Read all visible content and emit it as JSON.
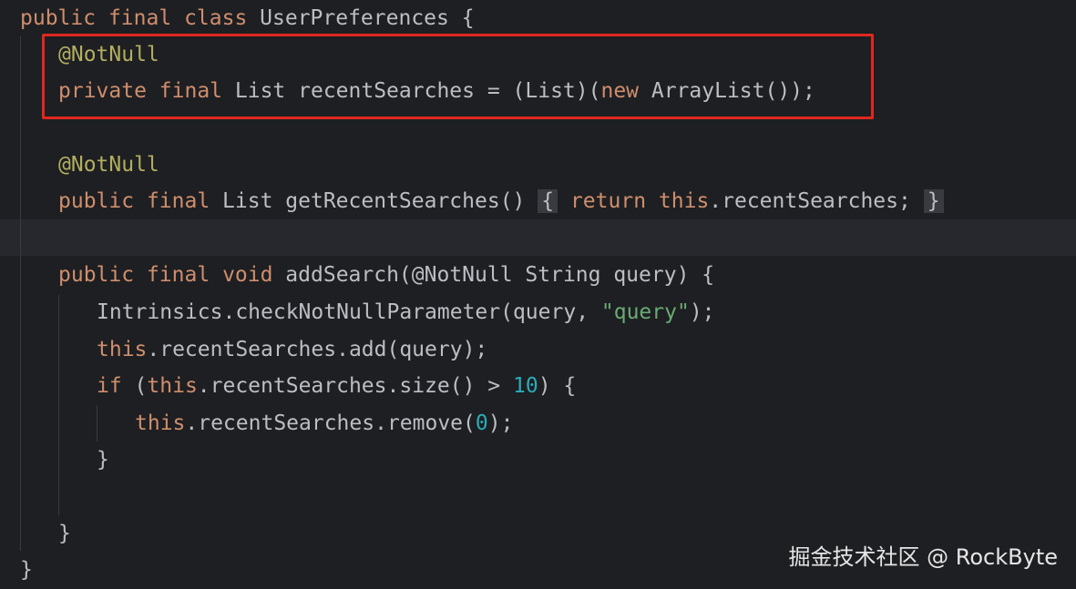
{
  "code": {
    "l1": {
      "kw1": "public",
      "kw2": "final",
      "kw3": "class",
      "rest": " UserPreferences {"
    },
    "l2": {
      "ann": "@NotNull"
    },
    "l3": {
      "kw1": "private",
      "kw2": "final",
      "p1": " List recentSearches = (List)(",
      "kw3": "new",
      "p2": " ArrayList());"
    },
    "l5": {
      "ann": "@NotNull"
    },
    "l6": {
      "kw1": "public",
      "kw2": "final",
      "p1": " List getRecentSearches() ",
      "fold_open": "{",
      "kw3": "return",
      "kw4": "this",
      "p2": ".recentSearches;",
      "fold_close": "}"
    },
    "l8": {
      "kw1": "public",
      "kw2": "final",
      "kw3": "void",
      "p1": " addSearch(@NotNull String query) {"
    },
    "l9": {
      "p1": "Intrinsics.checkNotNullParameter(query, ",
      "str": "\"query\"",
      "p2": ");"
    },
    "l10": {
      "kw": "this",
      "p1": ".recentSearches.add(query);"
    },
    "l11": {
      "kw1": "if",
      "p1": " (",
      "kw2": "this",
      "p2": ".recentSearches.size() > ",
      "num": "10",
      "p3": ") {"
    },
    "l12": {
      "kw": "this",
      "p1": ".recentSearches.remove(",
      "num": "0",
      "p2": ");"
    },
    "l13": {
      "p1": "}"
    },
    "l15": {
      "p1": "}"
    },
    "l16": {
      "p1": "}"
    }
  },
  "watermark": "掘金技术社区 @ RockByte",
  "colors": {
    "background": "#1e1f22",
    "keyword": "#cf8e6d",
    "annotation": "#b3ae60",
    "string": "#6aab73",
    "number": "#2aacb8",
    "text": "#bcbec4",
    "highlight_box": "#e0271f"
  }
}
